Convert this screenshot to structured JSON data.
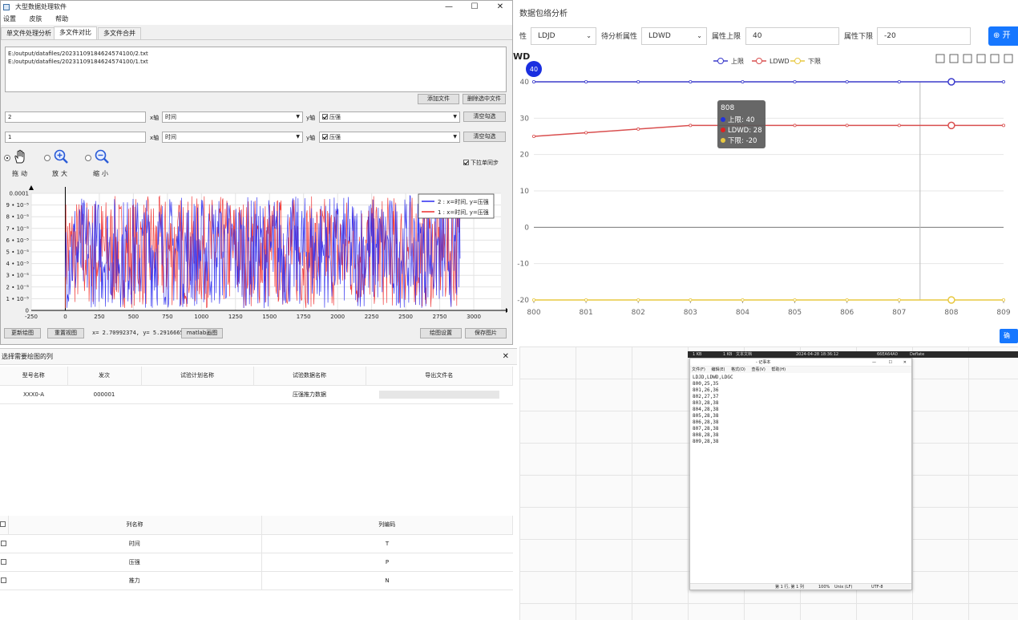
{
  "right_app": {
    "title": "数据包络分析",
    "attr_label": "性",
    "attr_value": "LDJD",
    "analyze_label": "待分析属性",
    "analyze_value": "LDWD",
    "upper_label": "属性上限",
    "upper_value": "40",
    "lower_label": "属性下限",
    "lower_value": "-20",
    "start_button": "开",
    "side_button": "确",
    "chart_label": "WD"
  },
  "chart_data": [
    {
      "type": "line",
      "x": [
        800,
        801,
        802,
        803,
        804,
        805,
        806,
        807,
        808,
        809
      ],
      "series": [
        {
          "name": "上限",
          "color": "#3b3bcc",
          "values": [
            40,
            40,
            40,
            40,
            40,
            40,
            40,
            40,
            40,
            40
          ]
        },
        {
          "name": "LDWD",
          "color": "#d94f4f",
          "values": [
            25,
            26,
            27,
            28,
            28,
            28,
            28,
            28,
            28,
            28
          ]
        },
        {
          "name": "下限",
          "color": "#e8c840",
          "values": [
            -20,
            -20,
            -20,
            -20,
            -20,
            -20,
            -20,
            -20,
            -20,
            -20
          ]
        }
      ],
      "ylim": [
        -20,
        40
      ],
      "yticks": [
        -20,
        -10,
        0,
        10,
        20,
        30,
        40
      ],
      "marker_badge": "40",
      "tooltip": {
        "title": "808",
        "rows": [
          {
            "text": "上限: 40",
            "color": "#2233dd"
          },
          {
            "text": "LDWD: 28",
            "color": "#dd2222"
          },
          {
            "text": "下限: -20",
            "color": "#e8c840"
          }
        ]
      },
      "grid": true,
      "legend": "top"
    },
    {
      "type": "line",
      "xticks": [
        -250,
        0,
        250,
        500,
        750,
        1000,
        1250,
        1500,
        1750,
        2000,
        2250,
        2500,
        2750,
        3000
      ],
      "yticks": [
        "0",
        "1 • 10⁻⁵",
        "2 • 10⁻⁵",
        "3 • 10⁻⁵",
        "4 • 10⁻⁵",
        "5 • 10⁻⁵",
        "6 • 10⁻⁵",
        "7 • 10⁻⁵",
        "8 • 10⁻⁵",
        "9 • 10⁻⁵",
        "0.0001"
      ],
      "xlim": [
        -250,
        3200
      ],
      "ylim": [
        0,
        0.0001
      ],
      "data_range": [
        0,
        2900
      ],
      "series": [
        {
          "name": "2 : x=时间, y=压强",
          "color": "#2b2bf0"
        },
        {
          "name": "1 : x=时间, y=压强",
          "color": "#ee2b2b"
        }
      ],
      "grid": true,
      "legend": "top-right"
    }
  ],
  "left_window": {
    "title": "大型数据处理软件",
    "menu": [
      "设置",
      "皮肤",
      "帮助"
    ],
    "tabs": [
      "单文件处理分析",
      "多文件对比",
      "多文件合并"
    ],
    "files": [
      "E:/output/datafiles/20231109184624574100/2.txt",
      "E:/output/datafiles/20231109184624574100/1.txt"
    ],
    "add_file": "添加文件",
    "delete_selected": "删除选中文件",
    "rows": [
      {
        "id": "2",
        "x_label": "x轴",
        "x_value": "时间",
        "y_label": "y轴",
        "y_value": "压强",
        "clear": "清空勾选"
      },
      {
        "id": "1",
        "x_label": "x轴",
        "x_value": "时间",
        "y_label": "y轴",
        "y_value": "压强",
        "clear": "清空勾选"
      }
    ],
    "tools": [
      "拖动",
      "放大",
      "缩小"
    ],
    "sync_label": "下拉单同步",
    "update_plot": "更新绘图",
    "reset_view": "重置视图",
    "coords": "x= 2.70992374, y= 5.29166651",
    "matlab_plot": "matlab画图",
    "plot_settings": "绘图设置",
    "save_image": "保存图片"
  },
  "dialog": {
    "title": "选择需要绘图的列",
    "top_headers": [
      "型号名称",
      "发次",
      "试验计划名称",
      "试验数据名称",
      "导出文件名"
    ],
    "top_row": [
      "XXX0-A",
      "000001",
      "",
      "压强推力数据",
      ""
    ],
    "col_headers": [
      "列名称",
      "列编码"
    ],
    "cols": [
      {
        "name": "时间",
        "code": "T"
      },
      {
        "name": "压强",
        "code": "P"
      },
      {
        "name": "推力",
        "code": "N"
      }
    ]
  },
  "notepad": {
    "tabbar": [
      "1 KB",
      "1 KB",
      "文本文档",
      "2024-04-28 18:36:12",
      "66EA64A0",
      "Deflate"
    ],
    "title": "- 记事本",
    "menu": [
      "文件(F)",
      "编辑(E)",
      "格式(O)",
      "查看(V)",
      "帮助(H)"
    ],
    "lines": [
      "LDJD,LDWD,LDGC",
      "800,25,35",
      "801,26,36",
      "802,27,37",
      "803,28,38",
      "804,28,38",
      "805,28,38",
      "806,28,38",
      "807,28,38",
      "808,28,38",
      "809,28,38"
    ],
    "status": [
      "第 1 行, 第 1 列",
      "100%",
      "Unix (LF)",
      "UTF-8"
    ]
  }
}
